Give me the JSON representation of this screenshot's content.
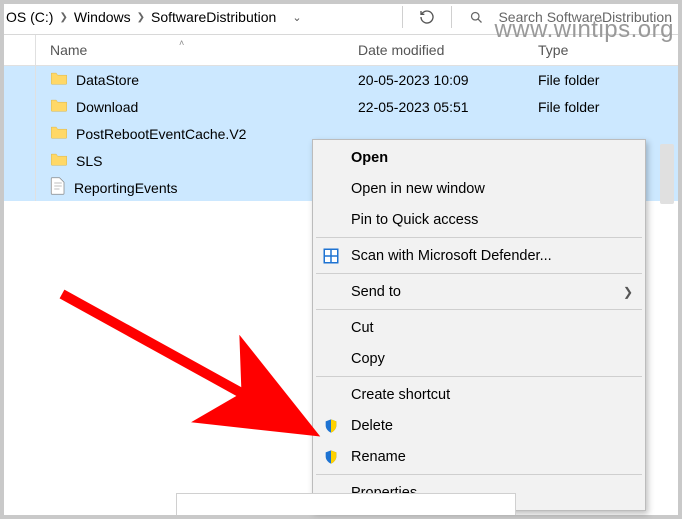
{
  "breadcrumb": {
    "part1": "OS (C:)",
    "part2": "Windows",
    "part3": "SoftwareDistribution"
  },
  "search_placeholder": "Search SoftwareDistribution",
  "watermark": "www.wintips.org",
  "columns": {
    "name": "Name",
    "date": "Date modified",
    "type": "Type"
  },
  "files": [
    {
      "name": "DataStore",
      "date": "20-05-2023 10:09",
      "type": "File folder",
      "kind": "folder",
      "selected": true
    },
    {
      "name": "Download",
      "date": "22-05-2023 05:51",
      "type": "File folder",
      "kind": "folder",
      "selected": true
    },
    {
      "name": "PostRebootEventCache.V2",
      "date": "",
      "type": "",
      "kind": "folder",
      "selected": true
    },
    {
      "name": "SLS",
      "date": "",
      "type": "",
      "kind": "folder",
      "selected": true
    },
    {
      "name": "ReportingEvents",
      "date": "",
      "type": "",
      "kind": "file",
      "selected": true
    }
  ],
  "context_menu": {
    "open": "Open",
    "open_new_window": "Open in new window",
    "pin_quick": "Pin to Quick access",
    "defender": "Scan with Microsoft Defender...",
    "send_to": "Send to",
    "cut": "Cut",
    "copy": "Copy",
    "create_shortcut": "Create shortcut",
    "delete": "Delete",
    "rename": "Rename",
    "properties": "Properties"
  }
}
